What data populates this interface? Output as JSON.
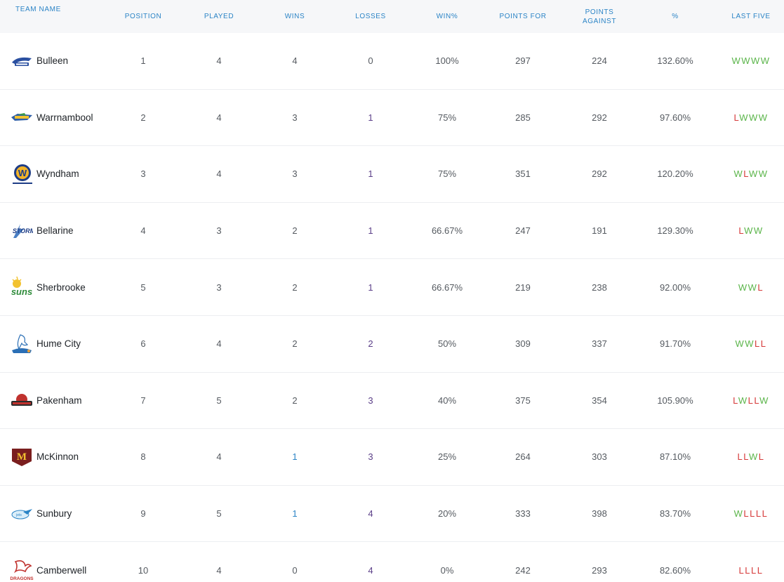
{
  "headers": {
    "team": "TEAM NAME",
    "position": "POSITION",
    "played": "PLAYED",
    "wins": "WINS",
    "losses": "LOSSES",
    "win_pct": "WIN%",
    "points_for": "POINTS FOR",
    "points_against": "POINTS AGAINST",
    "percentage": "%",
    "last_five": "LAST FIVE"
  },
  "colors": {
    "header_text": "#2b84c6",
    "win": "#5bb54a",
    "loss": "#d63a3a",
    "losses_value": "#5b3f88",
    "wins_value_low": "#2b84c6"
  },
  "teams": [
    {
      "name": "Bulleen",
      "logo_icon": "bulleen-boomers-logo-icon",
      "position": "1",
      "played": "4",
      "wins": "4",
      "losses": "0",
      "win_pct": "100%",
      "points_for": "297",
      "points_against": "224",
      "percentage": "132.60%",
      "last_five": "WWWW"
    },
    {
      "name": "Warrnambool",
      "logo_icon": "warrnambool-seahawks-logo-icon",
      "position": "2",
      "played": "4",
      "wins": "3",
      "losses": "1",
      "win_pct": "75%",
      "points_for": "285",
      "points_against": "292",
      "percentage": "97.60%",
      "last_five": "LWWW"
    },
    {
      "name": "Wyndham",
      "logo_icon": "wyndham-logo-icon",
      "position": "3",
      "played": "4",
      "wins": "3",
      "losses": "1",
      "win_pct": "75%",
      "points_for": "351",
      "points_against": "292",
      "percentage": "120.20%",
      "last_five": "WLWW"
    },
    {
      "name": "Bellarine",
      "logo_icon": "bellarine-storm-logo-icon",
      "position": "4",
      "played": "3",
      "wins": "2",
      "losses": "1",
      "win_pct": "66.67%",
      "points_for": "247",
      "points_against": "191",
      "percentage": "129.30%",
      "last_five": "LWW"
    },
    {
      "name": "Sherbrooke",
      "logo_icon": "sherbrooke-suns-logo-icon",
      "position": "5",
      "played": "3",
      "wins": "2",
      "losses": "1",
      "win_pct": "66.67%",
      "points_for": "219",
      "points_against": "238",
      "percentage": "92.00%",
      "last_five": "WWL"
    },
    {
      "name": "Hume City",
      "logo_icon": "hume-city-broncos-logo-icon",
      "position": "6",
      "played": "4",
      "wins": "2",
      "losses": "2",
      "win_pct": "50%",
      "points_for": "309",
      "points_against": "337",
      "percentage": "91.70%",
      "last_five": "WWLL"
    },
    {
      "name": "Pakenham",
      "logo_icon": "pakenham-warriors-logo-icon",
      "position": "7",
      "played": "5",
      "wins": "2",
      "losses": "3",
      "win_pct": "40%",
      "points_for": "375",
      "points_against": "354",
      "percentage": "105.90%",
      "last_five": "LWLLW"
    },
    {
      "name": "McKinnon",
      "logo_icon": "mckinnon-logo-icon",
      "position": "8",
      "played": "4",
      "wins": "1",
      "losses": "3",
      "win_pct": "25%",
      "points_for": "264",
      "points_against": "303",
      "percentage": "87.10%",
      "last_five": "LLWL"
    },
    {
      "name": "Sunbury",
      "logo_icon": "sunbury-jets-logo-icon",
      "position": "9",
      "played": "5",
      "wins": "1",
      "losses": "4",
      "win_pct": "20%",
      "points_for": "333",
      "points_against": "398",
      "percentage": "83.70%",
      "last_five": "WLLLL"
    },
    {
      "name": "Camberwell",
      "logo_icon": "camberwell-dragons-logo-icon",
      "position": "10",
      "played": "4",
      "wins": "0",
      "losses": "4",
      "win_pct": "0%",
      "points_for": "242",
      "points_against": "293",
      "percentage": "82.60%",
      "last_five": "LLLL"
    }
  ]
}
